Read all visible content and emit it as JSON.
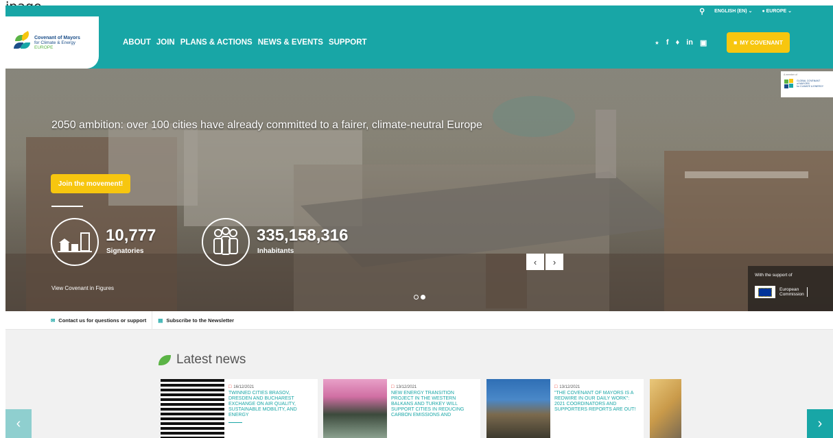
{
  "page_label": "ipage",
  "topbar": {
    "language": "ENGLISH (EN)",
    "region": "EUROPE"
  },
  "logo": {
    "line1": "Covenant of Mayors",
    "line2": "for Climate & Energy",
    "line3": "EUROPE"
  },
  "nav": [
    "ABOUT",
    "JOIN",
    "PLANS & ACTIONS",
    "NEWS & EVENTS",
    "SUPPORT"
  ],
  "my_covenant": "MY COVENANT",
  "hero": {
    "title": "2050 ambition: over 100 cities have already committed to a fairer, climate-neutral Europe",
    "join_button": "Join the movement!",
    "stat1_value": "10,777",
    "stat1_label": "Signatories",
    "stat2_value": "335,158,316",
    "stat2_label": "Inhabitants",
    "view_figures": "View Covenant in Figures"
  },
  "global_covenant": {
    "tag": "A member of",
    "line1": "GLOBAL COVENANT",
    "line2": "of MAYORS",
    "line3": "for CLIMATE & ENERGY"
  },
  "ec_badge": {
    "label": "With the support of",
    "line1": "European",
    "line2": "Commission"
  },
  "contact_bar": {
    "contact": "Contact us for questions or support",
    "newsletter": "Subscribe to the Newsletter"
  },
  "news": {
    "heading": "Latest news",
    "items": [
      {
        "date": "16/12/2021",
        "headline": "TWINNED CITIES BRASOV, DRESDEN AND BUCHAREST EXCHANGE ON AIR QUALITY, SUSTAINABLE MOBILITY, AND ENERGY"
      },
      {
        "date": "13/12/2021",
        "headline": "NEW ENERGY TRANSITION PROJECT IN THE WESTERN BALKANS AND TURKEY WILL SUPPORT CITIES IN REDUCING CARBON EMISSIONS AND"
      },
      {
        "date": "13/12/2021",
        "headline": "\"THE COVENANT OF MAYORS IS A REDWIRE IN OUR DAILY WORK\": 2021 COORDINATORS AND SUPPORTERS REPORTS ARE OUT!"
      }
    ]
  },
  "colors": {
    "teal": "#18a6a6",
    "yellow": "#f7c60f",
    "green": "#5bb446"
  }
}
